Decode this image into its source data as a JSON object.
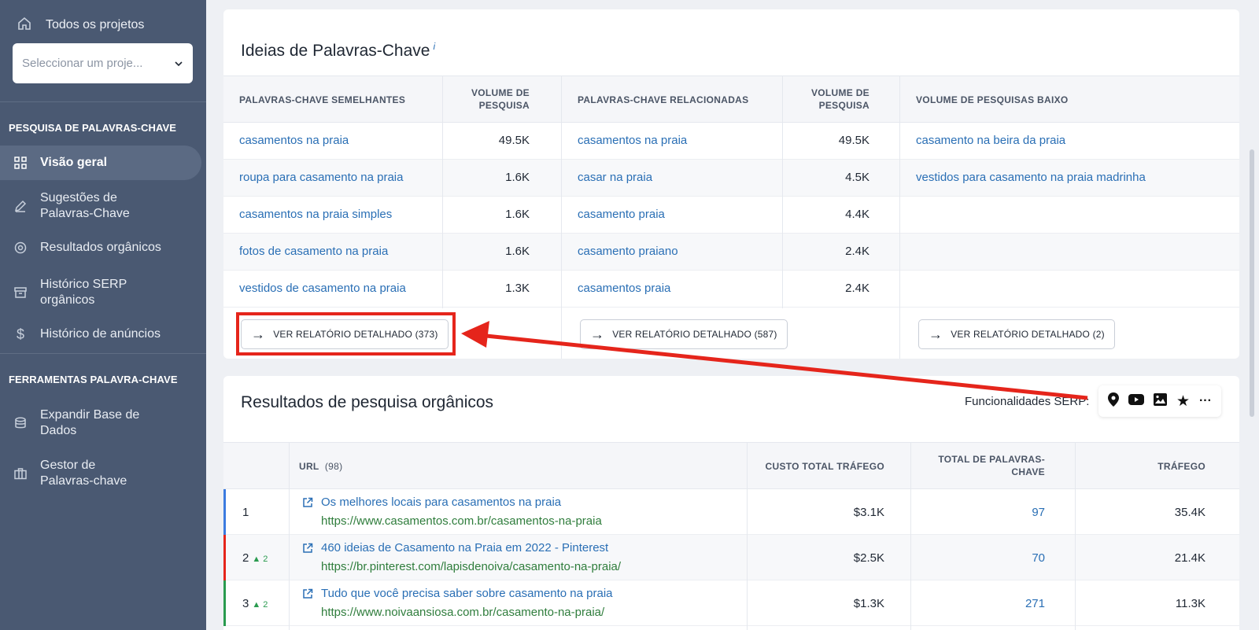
{
  "sidebar": {
    "all_projects": "Todos os projetos",
    "project_select_placeholder": "Seleccionar um proje...",
    "section1": "PESQUISA DE PALAVRAS-CHAVE",
    "items1": [
      {
        "label": "Visão geral",
        "icon": "grid-icon"
      },
      {
        "label": "Sugestões de Palavras-Chave",
        "icon": "pencil-icon"
      },
      {
        "label": "Resultados orgânicos",
        "icon": "target-icon"
      },
      {
        "label": "Histórico SERP orgânicos",
        "icon": "archive-icon"
      },
      {
        "label": "Histórico de anúncios",
        "icon": "dollar-icon"
      }
    ],
    "section2": "FERRAMENTAS PALAVRA-CHAVE",
    "items2": [
      {
        "label": "Expandir Base de Dados",
        "icon": "database-icon"
      },
      {
        "label": "Gestor de Palavras-chave",
        "icon": "briefcase-icon"
      }
    ]
  },
  "ideas": {
    "title": "Ideias de Palavras-Chave",
    "info_mark": "i",
    "headers": {
      "similar": "PALAVRAS-CHAVE SEMELHANTES",
      "volume": "VOLUME DE PESQUISA",
      "related": "PALAVRAS-CHAVE RELACIONADAS",
      "volume2": "VOLUME DE PESQUISA",
      "low": "VOLUME DE PESQUISAS BAIXO"
    },
    "rows": [
      {
        "similar": "casamentos na praia",
        "similar_vol": "49.5K",
        "related": "casamentos na praia",
        "related_vol": "49.5K",
        "low": "casamento na beira da praia"
      },
      {
        "similar": "roupa para casamento na praia",
        "similar_vol": "1.6K",
        "related": "casar na praia",
        "related_vol": "4.5K",
        "low": "vestidos para casamento na praia madrinha"
      },
      {
        "similar": "casamentos na praia simples",
        "similar_vol": "1.6K",
        "related": "casamento praia",
        "related_vol": "4.4K",
        "low": ""
      },
      {
        "similar": "fotos de casamento na praia",
        "similar_vol": "1.6K",
        "related": "casamento praiano",
        "related_vol": "2.4K",
        "low": ""
      },
      {
        "similar": "vestidos de casamento na praia",
        "similar_vol": "1.3K",
        "related": "casamentos praia",
        "related_vol": "2.4K",
        "low": ""
      }
    ],
    "buttons": [
      "VER RELATÓRIO DETALHADO (373)",
      "VER RELATÓRIO DETALHADO (587)",
      "VER RELATÓRIO DETALHADO (2)"
    ]
  },
  "organic": {
    "title": "Resultados de pesquisa orgânicos",
    "serp_label": "Funcionalidades SERP:",
    "serp_icons": [
      "map-pin-icon",
      "youtube-icon",
      "image-icon",
      "star-icon",
      "more-icon"
    ],
    "headers": {
      "url": "URL",
      "url_count": "(98)",
      "cost": "CUSTO TOTAL TRÁFEGO",
      "keywords": "TOTAL DE PALAVRAS-CHAVE",
      "traffic": "TRÁFEGO"
    },
    "rows": [
      {
        "pos": "1",
        "change": "",
        "title": "Os melhores locais para casamentos na praia",
        "url": "https://www.casamentos.com.br/casamentos-na-praia",
        "cost": "$3.1K",
        "keywords": "97",
        "traffic": "35.4K",
        "color": "#3b7be0"
      },
      {
        "pos": "2",
        "change": "▲ 2",
        "title": "460 ideias de Casamento na Praia em 2022 - Pinterest",
        "url": "https://br.pinterest.com/lapisdenoiva/casamento-na-praia/",
        "cost": "$2.5K",
        "keywords": "70",
        "traffic": "21.4K",
        "color": "#e5251b"
      },
      {
        "pos": "3",
        "change": "▲ 2",
        "title": "Tudo que você precisa saber sobre casamento na praia",
        "url": "https://www.noivaansiosa.com.br/casamento-na-praia/",
        "cost": "$1.3K",
        "keywords": "271",
        "traffic": "11.3K",
        "color": "#2a9b4f"
      }
    ]
  },
  "colors": {
    "sidebar_bg": "#4a5972",
    "link": "#2a6fb5",
    "url_green": "#2f7d3c",
    "annotation_red": "#e5251b"
  }
}
